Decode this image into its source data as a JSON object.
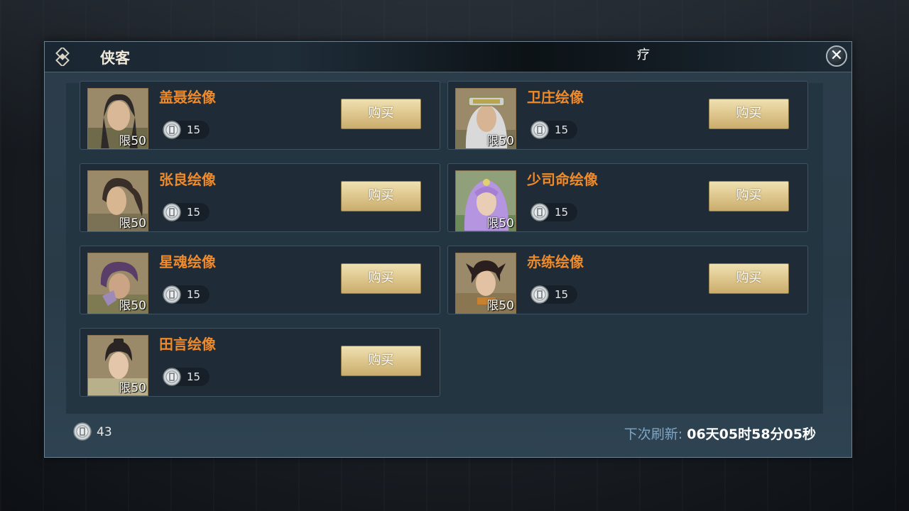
{
  "window": {
    "title": "侠客",
    "title_glyph": "疗",
    "close_icon": "close-icon"
  },
  "items": [
    {
      "name": "盖聂绘像",
      "limit": "限50",
      "price": "15",
      "buy_label": "购买",
      "portrait_hair": "#2e2a2a",
      "portrait_bg": "#9a8a6a"
    },
    {
      "name": "卫庄绘像",
      "limit": "限50",
      "price": "15",
      "buy_label": "购买",
      "portrait_hair": "#c9c9c9",
      "portrait_bg": "#9a8a6a"
    },
    {
      "name": "张良绘像",
      "limit": "限50",
      "price": "15",
      "buy_label": "购买",
      "portrait_hair": "#3a2e28",
      "portrait_bg": "#9a8a6a"
    },
    {
      "name": "少司命绘像",
      "limit": "限50",
      "price": "15",
      "buy_label": "购买",
      "portrait_hair": "#b595e0",
      "portrait_bg": "#8fa07a"
    },
    {
      "name": "星魂绘像",
      "limit": "限50",
      "price": "15",
      "buy_label": "购买",
      "portrait_hair": "#5a3e6a",
      "portrait_bg": "#9a8a6a"
    },
    {
      "name": "赤练绘像",
      "limit": "限50",
      "price": "15",
      "buy_label": "购买",
      "portrait_hair": "#2a1e1e",
      "portrait_bg": "#9a8a6a"
    },
    {
      "name": "田言绘像",
      "limit": "限50",
      "price": "15",
      "buy_label": "购买",
      "portrait_hair": "#2a2424",
      "portrait_bg": "#9a8a6a"
    }
  ],
  "footer": {
    "currency_icon": "silver-coin-icon",
    "balance": "43",
    "refresh_label": "下次刷新:",
    "refresh_value": "06天05时58分05秒"
  },
  "colors": {
    "item_name": "#f08a28",
    "buy_button": "#dcc48a",
    "refresh_label": "#7fa6c6"
  }
}
